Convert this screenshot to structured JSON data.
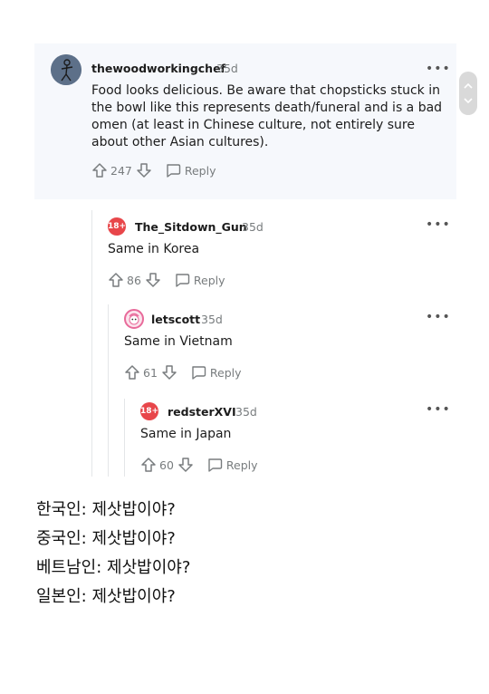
{
  "comments": {
    "main": {
      "username": "thewoodworkingchef",
      "age": "35d",
      "body": "Food looks delicious. Be aware that chopsticks stuck in the bowl like this represents death/funeral and is a bad omen (at least in Chinese culture, not entirely sure about other Asian cultures).",
      "votes": "247",
      "reply_label": "Reply"
    },
    "reply1": {
      "username": "The_Sitdown_Gun",
      "age": "35d",
      "badge": "18+",
      "body": "Same in Korea",
      "votes": "86",
      "reply_label": "Reply"
    },
    "reply2": {
      "username": "letscott",
      "age": "35d",
      "body": "Same in Vietnam",
      "votes": "61",
      "reply_label": "Reply"
    },
    "reply3": {
      "username": "redsterXVI",
      "age": "35d",
      "badge": "18+",
      "body": "Same in Japan",
      "votes": "60",
      "reply_label": "Reply"
    }
  },
  "more_glyph": "•••",
  "caption_lines": [
    "한국인: 제삿밥이야?",
    "중국인:  제삿밥이야?",
    "베트남인: 제삿밥이야?",
    "일본인: 제삿밥이야?"
  ],
  "colors": {
    "badge": "#e8464a",
    "meta": "#787c7e",
    "highlight_bg": "#f6f8fc"
  }
}
